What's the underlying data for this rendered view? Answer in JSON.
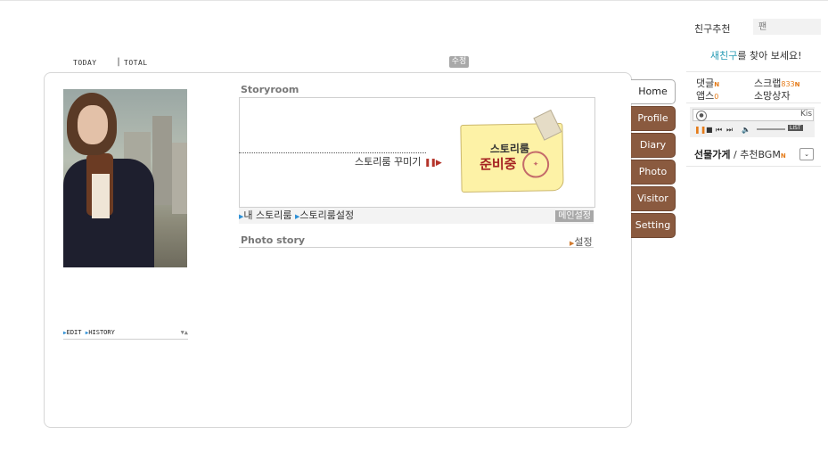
{
  "counters": {
    "today_label": "TODAY",
    "separator": "|",
    "total_label": "TOTAL"
  },
  "edit_badge": "수정",
  "profile": {
    "edit_label": "EDIT",
    "history_label": "HISTORY",
    "toggle_glyph": "▼▲"
  },
  "storyroom": {
    "title": "Storyroom",
    "decorate_label": "스토리룸 꾸미기",
    "decorate_marker": "❚❚▶",
    "note_line1": "스토리룸",
    "note_line2": "준비중",
    "links": {
      "my_storyroom": "내 스토리룸",
      "settings": "스토리룸설정",
      "main_setting": "메인설정"
    }
  },
  "photo_story": {
    "title": "Photo story",
    "setting_label": "설정"
  },
  "tabs": [
    {
      "label": "Home",
      "active": true
    },
    {
      "label": "Profile",
      "active": false
    },
    {
      "label": "Diary",
      "active": false
    },
    {
      "label": "Photo",
      "active": false
    },
    {
      "label": "Visitor",
      "active": false
    },
    {
      "label": "Setting",
      "active": false
    }
  ],
  "sidebar": {
    "friend_recommend": "친구추천",
    "fan_placeholder": "팬",
    "find_friend_highlight": "새친구",
    "find_friend_rest": "를 찾아 보세요!",
    "comments_label": "댓글",
    "new_badge": "N",
    "scrap_label": "스크랩",
    "scrap_count": "833",
    "apps_label": "앱스",
    "apps_count": "0",
    "wishbox_label": "소망상자",
    "player": {
      "song": "Kis",
      "list_label": "LIST",
      "controls": {
        "pause": "❚❚",
        "stop": "■",
        "prev": "⏮",
        "next": "⏭",
        "volume": "🔈"
      }
    },
    "gift_label": "선물가게",
    "bgm_sep": "/",
    "bgm_label": "추천BGM",
    "dropdown_glyph": "⌄"
  },
  "colors": {
    "tab_brown": "#8a5a3f",
    "accent_orange": "#e57b19",
    "link_teal": "#2a9cb5"
  }
}
